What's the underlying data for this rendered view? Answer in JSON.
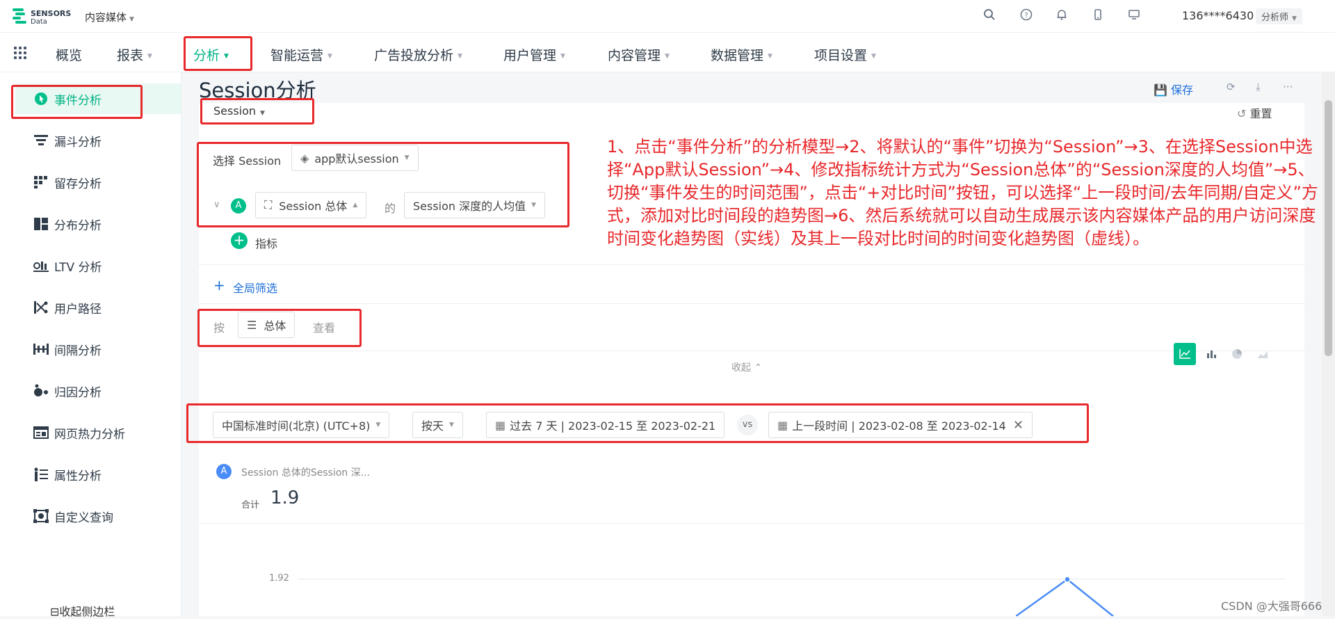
{
  "header": {
    "logo_line1": "SENSORS",
    "logo_line2": "Data",
    "project": "内容媒体",
    "user": "136****6430",
    "role": "分析师"
  },
  "nav": {
    "items": [
      {
        "label": "概览"
      },
      {
        "label": "报表"
      },
      {
        "label": "分析"
      },
      {
        "label": "智能运营"
      },
      {
        "label": "广告投放分析"
      },
      {
        "label": "用户管理"
      },
      {
        "label": "内容管理"
      },
      {
        "label": "数据管理"
      },
      {
        "label": "项目设置"
      }
    ]
  },
  "sidebar": {
    "items": [
      {
        "label": "事件分析",
        "icon": "event-analysis-icon"
      },
      {
        "label": "漏斗分析",
        "icon": "funnel-icon"
      },
      {
        "label": "留存分析",
        "icon": "retention-icon"
      },
      {
        "label": "分布分析",
        "icon": "distribution-icon"
      },
      {
        "label": "LTV 分析",
        "icon": "ltv-icon"
      },
      {
        "label": "用户路径",
        "icon": "user-path-icon"
      },
      {
        "label": "间隔分析",
        "icon": "interval-icon"
      },
      {
        "label": "归因分析",
        "icon": "attribution-icon"
      },
      {
        "label": "网页热力分析",
        "icon": "heatmap-icon"
      },
      {
        "label": "属性分析",
        "icon": "property-icon"
      },
      {
        "label": "自定义查询",
        "icon": "custom-query-icon"
      }
    ],
    "collapse_label": "收起侧边栏"
  },
  "page": {
    "title": "Session分析",
    "save": "保存",
    "reset": "重置",
    "session_type": "Session",
    "select_session_label": "选择 Session",
    "session_value": "app默认session",
    "metric_badge": "A",
    "metric_scope": "Session 总体",
    "metric_of": "的",
    "metric_stat": "Session 深度的人均值",
    "add_metric": "指标",
    "global_filter": "全局筛选",
    "group_by_label": "按",
    "group_by_value": "总体",
    "group_by_suffix": "查看",
    "collapse": "收起"
  },
  "query_bar": {
    "timezone": "中国标准时间(北京) (UTC+8)",
    "granularity": "按天",
    "date_range": "过去 7 天 | 2023-02-15 至 2023-02-21",
    "vs": "vs",
    "compare_range": "上一段时间 | 2023-02-08 至 2023-02-14"
  },
  "result": {
    "metric_badge": "A",
    "metric_name": "Session 总体的Session 深...",
    "total_label": "合计",
    "total_value": "1.9",
    "y_tick": "1.92"
  },
  "annotation": "1、点击“事件分析”的分析模型→2、将默认的“事件”切换为“Session”→3、在选择Session中选择“App默认Session”→4、修改指标统计方式为“Session总体”的“Session深度的人均值”→5、切换“事件发生的时间范围”，点击“+对比时间”按钮，可以选择“上一段时间/去年同期/自定义”方式，添加对比时间段的趋势图→6、然后系统就可以自动生成展示该内容媒体产品的用户访问深度时间变化趋势图（实线）及其上一段对比时间的时间变化趋势图（虚线）。",
  "watermark": "CSDN @大强哥666",
  "colors": {
    "accent": "#00b386",
    "annotation": "#e8282b",
    "link": "#1e6fd9"
  }
}
